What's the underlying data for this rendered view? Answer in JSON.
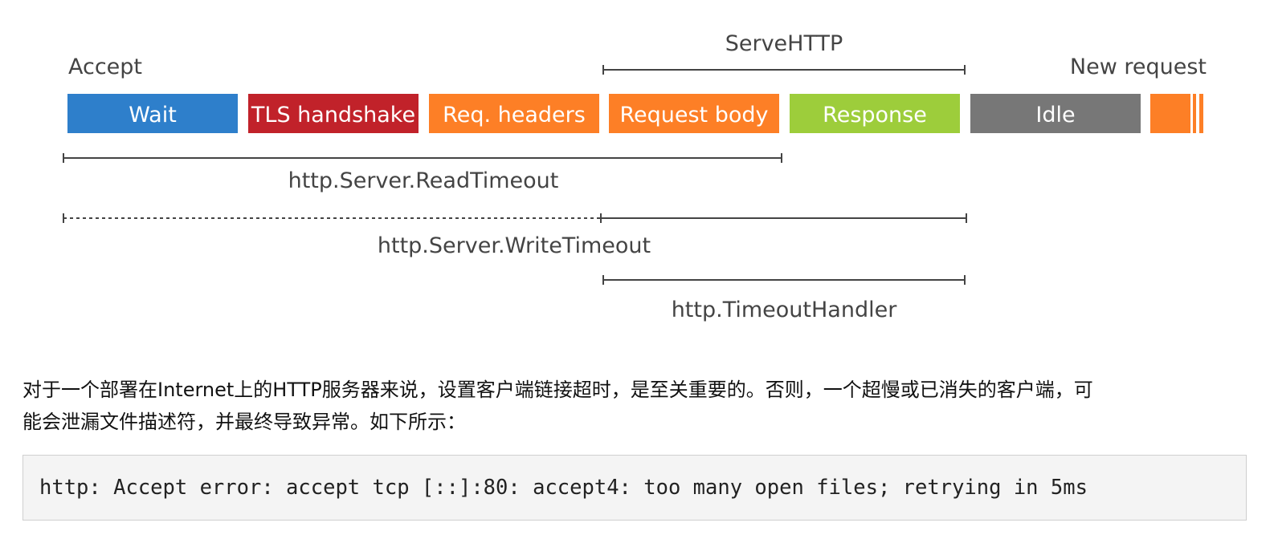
{
  "diagram": {
    "accept_label": "Accept",
    "new_request_label": "New request",
    "servehttp_label": "ServeHTTP",
    "segments": [
      {
        "label": "Wait",
        "color": "#2e7fcb"
      },
      {
        "label": "TLS handshake",
        "color": "#c1222a"
      },
      {
        "label": "Req. headers",
        "color": "#fd7f26"
      },
      {
        "label": "Request body",
        "color": "#fd7f26"
      },
      {
        "label": "Response",
        "color": "#9dcd3b"
      },
      {
        "label": "Idle",
        "color": "#777777"
      }
    ],
    "next_request_color": "#fd7f26",
    "read_timeout_label": "http.Server.ReadTimeout",
    "write_timeout_label": "http.Server.WriteTimeout",
    "timeout_handler_label": "http.TimeoutHandler"
  },
  "paragraph": {
    "line1": "对于一个部署在Internet上的HTTP服务器来说，设置客户端链接超时，是至关重要的。否则，一个超慢或已消失的客户端，可",
    "line2": "能会泄漏文件描述符，并最终导致异常。如下所示："
  },
  "code": {
    "text": "http: Accept error: accept tcp [::]:80: accept4: too many open files; retrying in 5ms"
  }
}
